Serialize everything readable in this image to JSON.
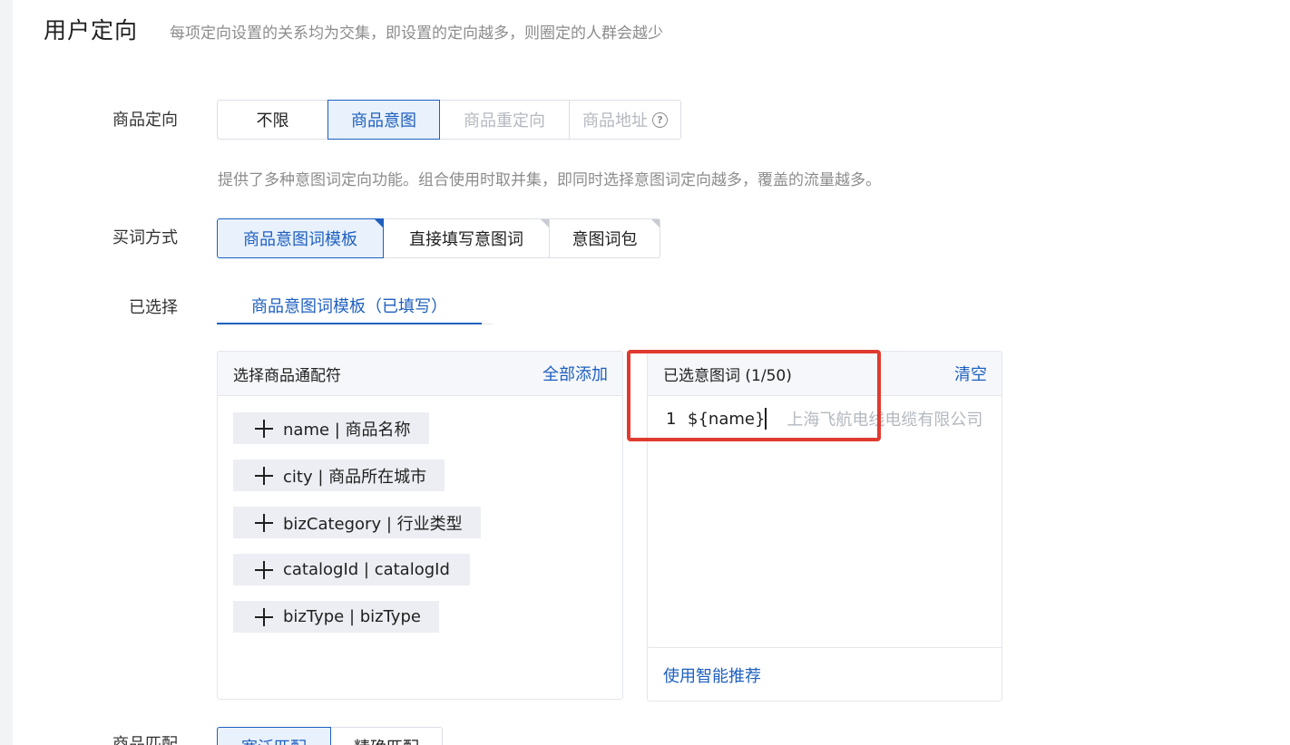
{
  "section": {
    "title": "用户定向",
    "subtitle": "每项定向设置的关系均为交集，即设置的定向越多，则圈定的人群会越少"
  },
  "product_targeting": {
    "label": "商品定向",
    "options": [
      {
        "label": "不限",
        "state": "normal"
      },
      {
        "label": "商品意图",
        "state": "active"
      },
      {
        "label": "商品重定向",
        "state": "disabled"
      },
      {
        "label": "商品地址",
        "state": "disabled",
        "icon": "help-circle-icon",
        "icon_glyph": "?"
      }
    ],
    "hint": "提供了多种意图词定向功能。组合使用时取并集，即同时选择意图词定向越多，覆盖的流量越多。"
  },
  "buy_method": {
    "label": "买词方式",
    "options": [
      {
        "label": "商品意图词模板",
        "state": "active"
      },
      {
        "label": "直接填写意图词",
        "state": "normal"
      },
      {
        "label": "意图词包",
        "state": "normal"
      }
    ]
  },
  "selected": {
    "label": "已选择",
    "tab": "商品意图词模板（已填写）"
  },
  "wildcard_panel": {
    "title": "选择商品通配符",
    "add_all": "全部添加",
    "chips": [
      "name | 商品名称",
      "city | 商品所在城市",
      "bizCategory | 行业类型",
      "catalogId | catalogId",
      "bizType | bizType"
    ]
  },
  "selected_panel": {
    "title": "已选意图词 (1/50)",
    "clear": "清空",
    "line_no": "1",
    "value": "${name}",
    "placeholder": "上海飞航电线电缆有限公司",
    "footer": "使用智能推荐"
  },
  "product_match": {
    "label": "商品匹配",
    "options": [
      {
        "label": "宽泛匹配",
        "state": "active"
      },
      {
        "label": "精确匹配",
        "state": "normal"
      }
    ]
  },
  "colors": {
    "accent": "#1e5fbf",
    "highlight": "#e03a2f"
  }
}
